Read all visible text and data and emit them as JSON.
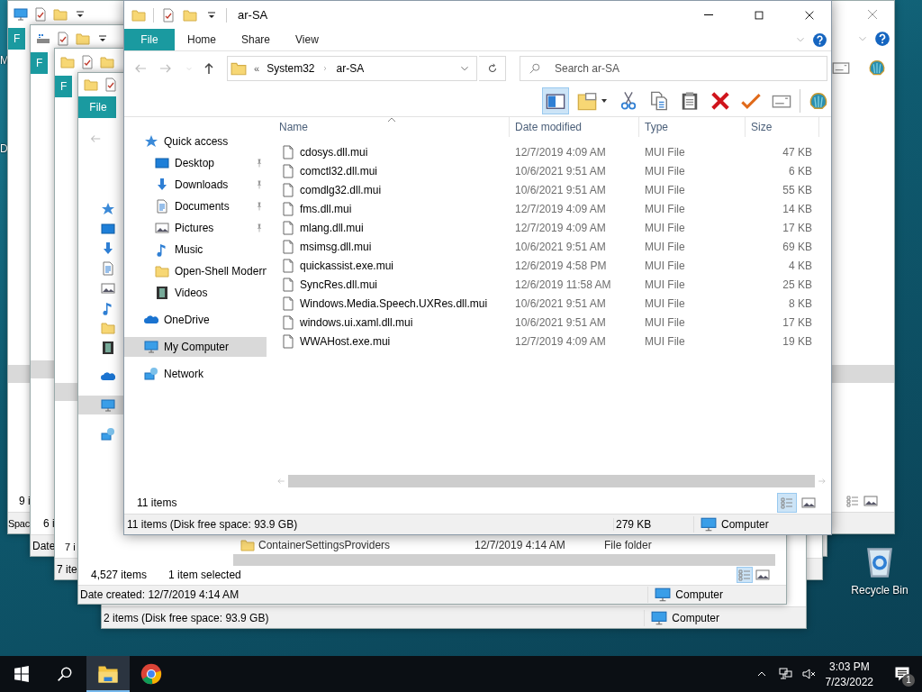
{
  "desktop_icons": [
    {
      "kind": "cut",
      "label": "M"
    },
    {
      "kind": "cut",
      "label": "D"
    },
    {
      "kind": "recycle-bin",
      "label": "Recycle Bin"
    }
  ],
  "background_windows": [
    {
      "tab": "F",
      "item_count": "9 i",
      "status": "Spac"
    },
    {
      "tab": "F",
      "item_count": "6 i",
      "status": "Date"
    },
    {
      "tab": "F",
      "item_count": "7 i",
      "status": "7 ite"
    },
    {
      "tab": "File",
      "item_count": "4,527 items",
      "selection": "1 item selected",
      "status": "Date created: 12/7/2019 4:14 AM",
      "location": "Computer",
      "row": {
        "name": "ContainerSettingsProviders",
        "date": "12/7/2019 4:14 AM",
        "type": "File folder"
      }
    },
    {
      "status": "2 items (Disk free space: 93.9 GB)",
      "location": "Computer"
    }
  ],
  "window": {
    "title": "ar-SA"
  },
  "ribbon_tabs": [
    {
      "kind": "file",
      "label": "File"
    },
    {
      "kind": "tab",
      "label": "Home"
    },
    {
      "kind": "tab",
      "label": "Share"
    },
    {
      "kind": "tab",
      "label": "View"
    }
  ],
  "address": {
    "overflow_mark": "«",
    "path": [
      "System32",
      "ar-SA"
    ]
  },
  "search": {
    "placeholder": "Search ar-SA"
  },
  "toolbar": {
    "pane_toggle": {
      "on": true
    },
    "actions": [
      {
        "kind": "folder-options"
      },
      {
        "kind": "cut"
      },
      {
        "kind": "copy"
      },
      {
        "kind": "paste"
      },
      {
        "kind": "delete"
      },
      {
        "kind": "check"
      },
      {
        "kind": "rename"
      },
      {
        "kind": "shell"
      }
    ]
  },
  "nav": [
    {
      "kind": "star",
      "label": "Quick access",
      "selected": false,
      "children": [
        {
          "kind": "desktop",
          "label": "Desktop",
          "pinned": true,
          "selected": false
        },
        {
          "kind": "downloads",
          "label": "Downloads",
          "pinned": true,
          "selected": false
        },
        {
          "kind": "documents",
          "label": "Documents",
          "pinned": true,
          "selected": false
        },
        {
          "kind": "pictures",
          "label": "Pictures",
          "pinned": true,
          "selected": false
        },
        {
          "kind": "music",
          "label": "Music",
          "pinned": false,
          "selected": false
        },
        {
          "kind": "folder",
          "label": "Open-Shell Modern",
          "pinned": false,
          "selected": false
        },
        {
          "kind": "videos",
          "label": "Videos",
          "pinned": false,
          "selected": false
        }
      ]
    },
    {
      "kind": "onedrive",
      "label": "OneDrive",
      "selected": false
    },
    {
      "kind": "computer",
      "label": "My Computer",
      "selected": true
    },
    {
      "kind": "network",
      "label": "Network",
      "selected": false
    }
  ],
  "columns": [
    {
      "label": "Name",
      "sorted": true
    },
    {
      "label": "Date modified",
      "sorted": false
    },
    {
      "label": "Type",
      "sorted": false
    },
    {
      "label": "Size",
      "sorted": false
    }
  ],
  "files": [
    {
      "name": "cdosys.dll.mui",
      "date": "12/7/2019 4:09 AM",
      "type": "MUI File",
      "size": "47 KB"
    },
    {
      "name": "comctl32.dll.mui",
      "date": "10/6/2021 9:51 AM",
      "type": "MUI File",
      "size": "6 KB"
    },
    {
      "name": "comdlg32.dll.mui",
      "date": "10/6/2021 9:51 AM",
      "type": "MUI File",
      "size": "55 KB"
    },
    {
      "name": "fms.dll.mui",
      "date": "12/7/2019 4:09 AM",
      "type": "MUI File",
      "size": "14 KB"
    },
    {
      "name": "mlang.dll.mui",
      "date": "12/7/2019 4:09 AM",
      "type": "MUI File",
      "size": "17 KB"
    },
    {
      "name": "msimsg.dll.mui",
      "date": "10/6/2021 9:51 AM",
      "type": "MUI File",
      "size": "69 KB"
    },
    {
      "name": "quickassist.exe.mui",
      "date": "12/6/2019 4:58 PM",
      "type": "MUI File",
      "size": "4 KB"
    },
    {
      "name": "SyncRes.dll.mui",
      "date": "12/6/2019 11:58 AM",
      "type": "MUI File",
      "size": "25 KB"
    },
    {
      "name": "Windows.Media.Speech.UXRes.dll.mui",
      "date": "10/6/2021 9:51 AM",
      "type": "MUI File",
      "size": "8 KB"
    },
    {
      "name": "windows.ui.xaml.dll.mui",
      "date": "10/6/2021 9:51 AM",
      "type": "MUI File",
      "size": "17 KB"
    },
    {
      "name": "WWAHost.exe.mui",
      "date": "12/7/2019 4:09 AM",
      "type": "MUI File",
      "size": "19 KB"
    }
  ],
  "item_count": "11 items",
  "view_buttons": [
    {
      "kind": "details",
      "selected": true
    },
    {
      "kind": "large-icons",
      "selected": false
    }
  ],
  "status_bar": {
    "summary": "11 items (Disk free space: 93.9 GB)",
    "size": "279 KB",
    "location": "Computer"
  },
  "taskbar": {
    "apps": [
      {
        "kind": "explorer",
        "active": true
      },
      {
        "kind": "chrome",
        "active": false
      }
    ],
    "clock": {
      "time": "3:03 PM",
      "date": "7/23/2022"
    },
    "notification_count": "1"
  }
}
